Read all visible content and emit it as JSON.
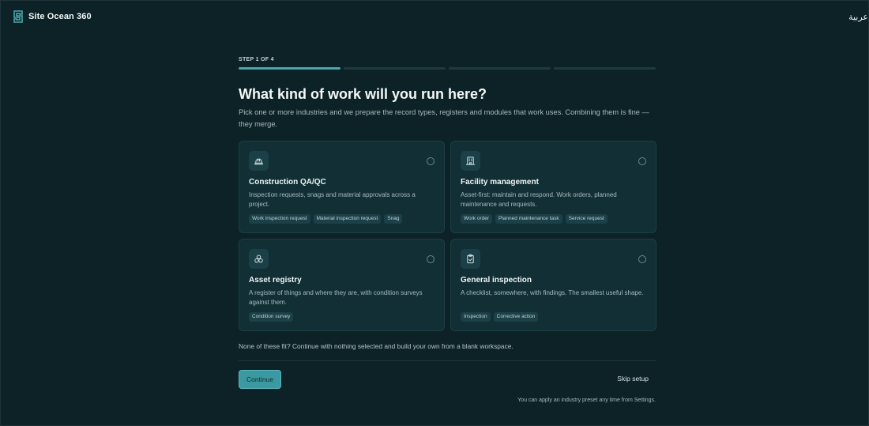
{
  "app": {
    "title": "Site Ocean 360",
    "logo_icon": "site-ocean-logo",
    "language_toggle": "عربية"
  },
  "onboarding": {
    "step_label": "STEP 1 OF 4",
    "progress": {
      "current_step": 1,
      "total_steps": 4
    },
    "heading": "What kind of work will you run here?",
    "subtitle": "Pick one or more industries and we prepare the record types, registers and modules that work uses. Combining them is fine — they merge.",
    "industries": [
      {
        "icon": "hard-hat-icon",
        "title": "Construction QA/QC",
        "description": "Inspection requests, snags and material approvals across a project.",
        "tags": [
          "Work inspection request",
          "Material inspection request",
          "Snag"
        ],
        "selected": false
      },
      {
        "icon": "building-icon",
        "title": "Facility management",
        "description": "Asset-first: maintain and respond. Work orders, planned maintenance and requests.",
        "tags": [
          "Work order",
          "Planned maintenance task",
          "Service request"
        ],
        "selected": false
      },
      {
        "icon": "boxes-icon",
        "title": "Asset registry",
        "description": "A register of things and where they are, with condition surveys against them.",
        "tags": [
          "Condition survey"
        ],
        "selected": false
      },
      {
        "icon": "clipboard-check-icon",
        "title": "General inspection",
        "description": "A checklist, somewhere, with findings. The smallest useful shape.",
        "tags": [
          "Inspection",
          "Corrective action"
        ],
        "selected": false
      }
    ],
    "none_fit_text": "None of these fit? Continue with nothing selected and build your own from a blank workspace.",
    "continue_label": "Continue",
    "skip_label": "Skip setup",
    "hint": "You can apply an industry preset any time from Settings."
  },
  "colors": {
    "background": "#0c2226",
    "card": "#112f35",
    "accent": "#3b9aa1"
  }
}
